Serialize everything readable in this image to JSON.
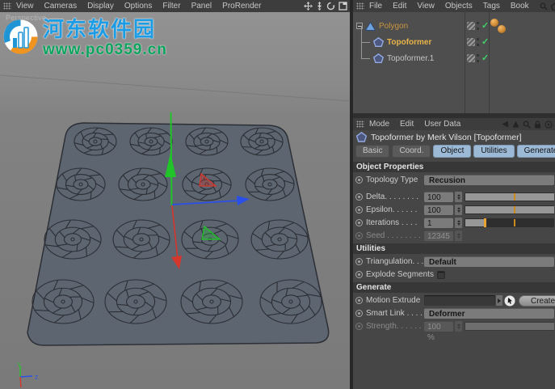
{
  "watermark": {
    "title": "河东软件园",
    "url": "www.pc0359.cn",
    "title_color": "#1b9ce4",
    "url_color": "#0aa45e"
  },
  "viewport": {
    "label": "Perspective",
    "menu": [
      "View",
      "Cameras",
      "Display",
      "Options",
      "Filter",
      "Panel",
      "ProRender"
    ],
    "tool_icons": [
      "move-icon",
      "dolly-icon",
      "rotate-icon",
      "maximize-icon"
    ]
  },
  "object_manager": {
    "menu": [
      "File",
      "Edit",
      "View",
      "Objects",
      "Tags",
      "Book"
    ],
    "corner_icons": [
      "search-icon",
      "home-icon"
    ],
    "objects": [
      {
        "name": "Polygon",
        "icon": "polygon-object-icon",
        "depth": 0,
        "expanded": true,
        "name_color": "#c9953f",
        "bold": false,
        "enabled_check": true,
        "tags": [
          "material-tag",
          "material-tag"
        ]
      },
      {
        "name": "Topoformer",
        "icon": "topoformer-object-icon",
        "depth": 1,
        "name_color": "#e7b449",
        "bold": true,
        "enabled_check": true,
        "tags": []
      },
      {
        "name": "Topoformer.1",
        "icon": "topoformer-object-icon",
        "depth": 1,
        "name_color": "#c4c4c4",
        "bold": false,
        "enabled_check": true,
        "tags": []
      }
    ]
  },
  "attribute_manager": {
    "menu": [
      "Mode",
      "Edit",
      "User Data"
    ],
    "corner_icons": [
      "back-icon",
      "forward-icon",
      "search-icon",
      "lock-icon",
      "target-icon"
    ],
    "title": "Topoformer by Merk Vilson [Topoformer]",
    "tabs": [
      {
        "label": "Basic",
        "active": false
      },
      {
        "label": "Coord.",
        "active": false
      },
      {
        "label": "Object",
        "active": true
      },
      {
        "label": "Utilities",
        "active": true
      },
      {
        "label": "Generate",
        "active": true
      }
    ],
    "sections": [
      {
        "header": "Object Properties",
        "rows": [
          {
            "label": "Topology Type",
            "type": "dropdown",
            "value": "Recusion",
            "gap_after": true
          },
          {
            "label": "Delta. . . . . . . .",
            "type": "number-slider",
            "value": "100 %",
            "fill": 1
          },
          {
            "label": "Epsilon. . . . . .",
            "type": "number-slider",
            "value": "100 %",
            "fill": 1
          },
          {
            "label": "Iterations . . . .",
            "type": "number-slider",
            "value": "1",
            "fill": 0.23,
            "handle": true
          },
          {
            "label": "Seed . . . . . . . .",
            "type": "number",
            "value": "12345",
            "disabled": true
          }
        ]
      },
      {
        "header": "Utilities",
        "rows": [
          {
            "label": "Triangulation. . . .",
            "type": "dropdown",
            "value": "Default"
          },
          {
            "label": "Explode Segments",
            "type": "checkbox",
            "checked": false
          }
        ]
      },
      {
        "header": "Generate",
        "rows": [
          {
            "label": "Motion Extrude",
            "type": "link",
            "value": "",
            "button": "Create"
          },
          {
            "label": "Smart Link . . . .",
            "type": "dropdown",
            "value": "Deformer"
          },
          {
            "label": "Strength. . . . . .",
            "type": "number-slider",
            "value": "100 %",
            "fill": 1,
            "disabled": true
          }
        ]
      }
    ]
  }
}
